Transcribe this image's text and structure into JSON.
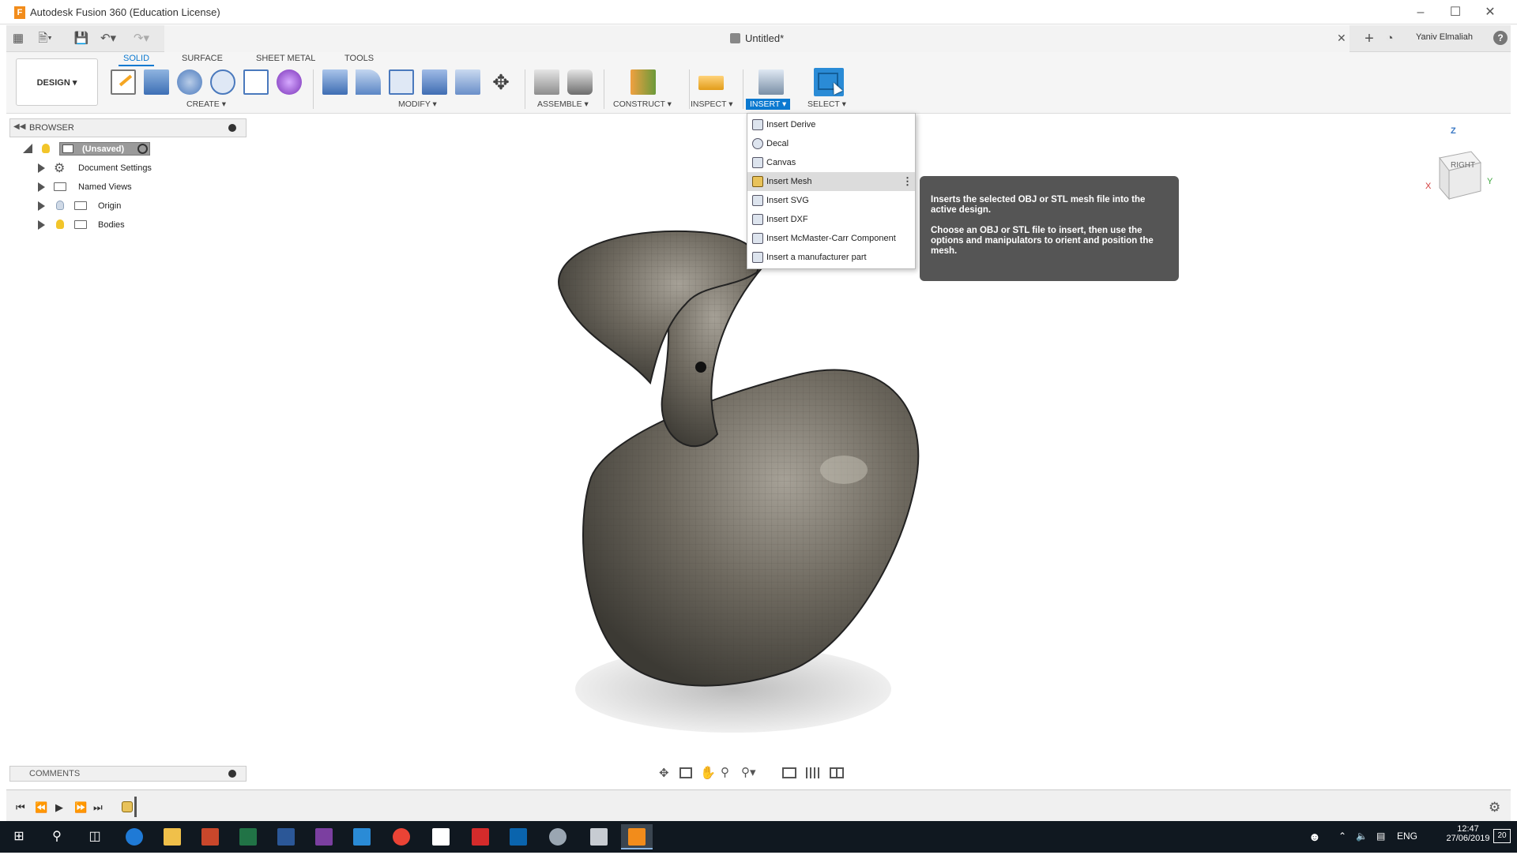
{
  "window": {
    "title": "Autodesk Fusion 360 (Education License)",
    "logo_letter": "F"
  },
  "appbar": {
    "doc_name": "Untitled*",
    "user": "Yaniv Elmaliah",
    "help_label": "?"
  },
  "ribbon": {
    "workspace": "DESIGN ▾",
    "tabs": [
      "SOLID",
      "SURFACE",
      "SHEET METAL",
      "TOOLS"
    ],
    "groups": [
      "CREATE ▾",
      "MODIFY ▾",
      "ASSEMBLE ▾",
      "CONSTRUCT ▾",
      "INSPECT ▾",
      "INSERT ▾",
      "SELECT ▾"
    ]
  },
  "browser": {
    "title": "BROWSER",
    "items": [
      "(Unsaved)",
      "Document Settings",
      "Named Views",
      "Origin",
      "Bodies"
    ]
  },
  "insert_menu": {
    "items": [
      "Insert Derive",
      "Decal",
      "Canvas",
      "Insert Mesh",
      "Insert SVG",
      "Insert DXF",
      "Insert McMaster-Carr Component",
      "Insert a manufacturer part"
    ],
    "highlighted": "Insert Mesh"
  },
  "tooltip": {
    "line1": "Inserts the selected OBJ or STL mesh file into the active design.",
    "line2": "Choose an OBJ or STL file to insert, then use the options and manipulators to orient and position the mesh."
  },
  "viewcube": {
    "face": "RIGHT",
    "axis_z": "Z",
    "axis_x": "X",
    "axis_y": "Y"
  },
  "comments": {
    "title": "COMMENTS"
  },
  "taskbar": {
    "lang": "ENG",
    "time": "12:47",
    "date": "27/06/2019",
    "notif_count": "20"
  },
  "colors": {
    "accent": "#0b79d0",
    "body_fill": "#6e6a60",
    "tooltip_bg": "#555555",
    "taskbar_bg": "#101820"
  }
}
